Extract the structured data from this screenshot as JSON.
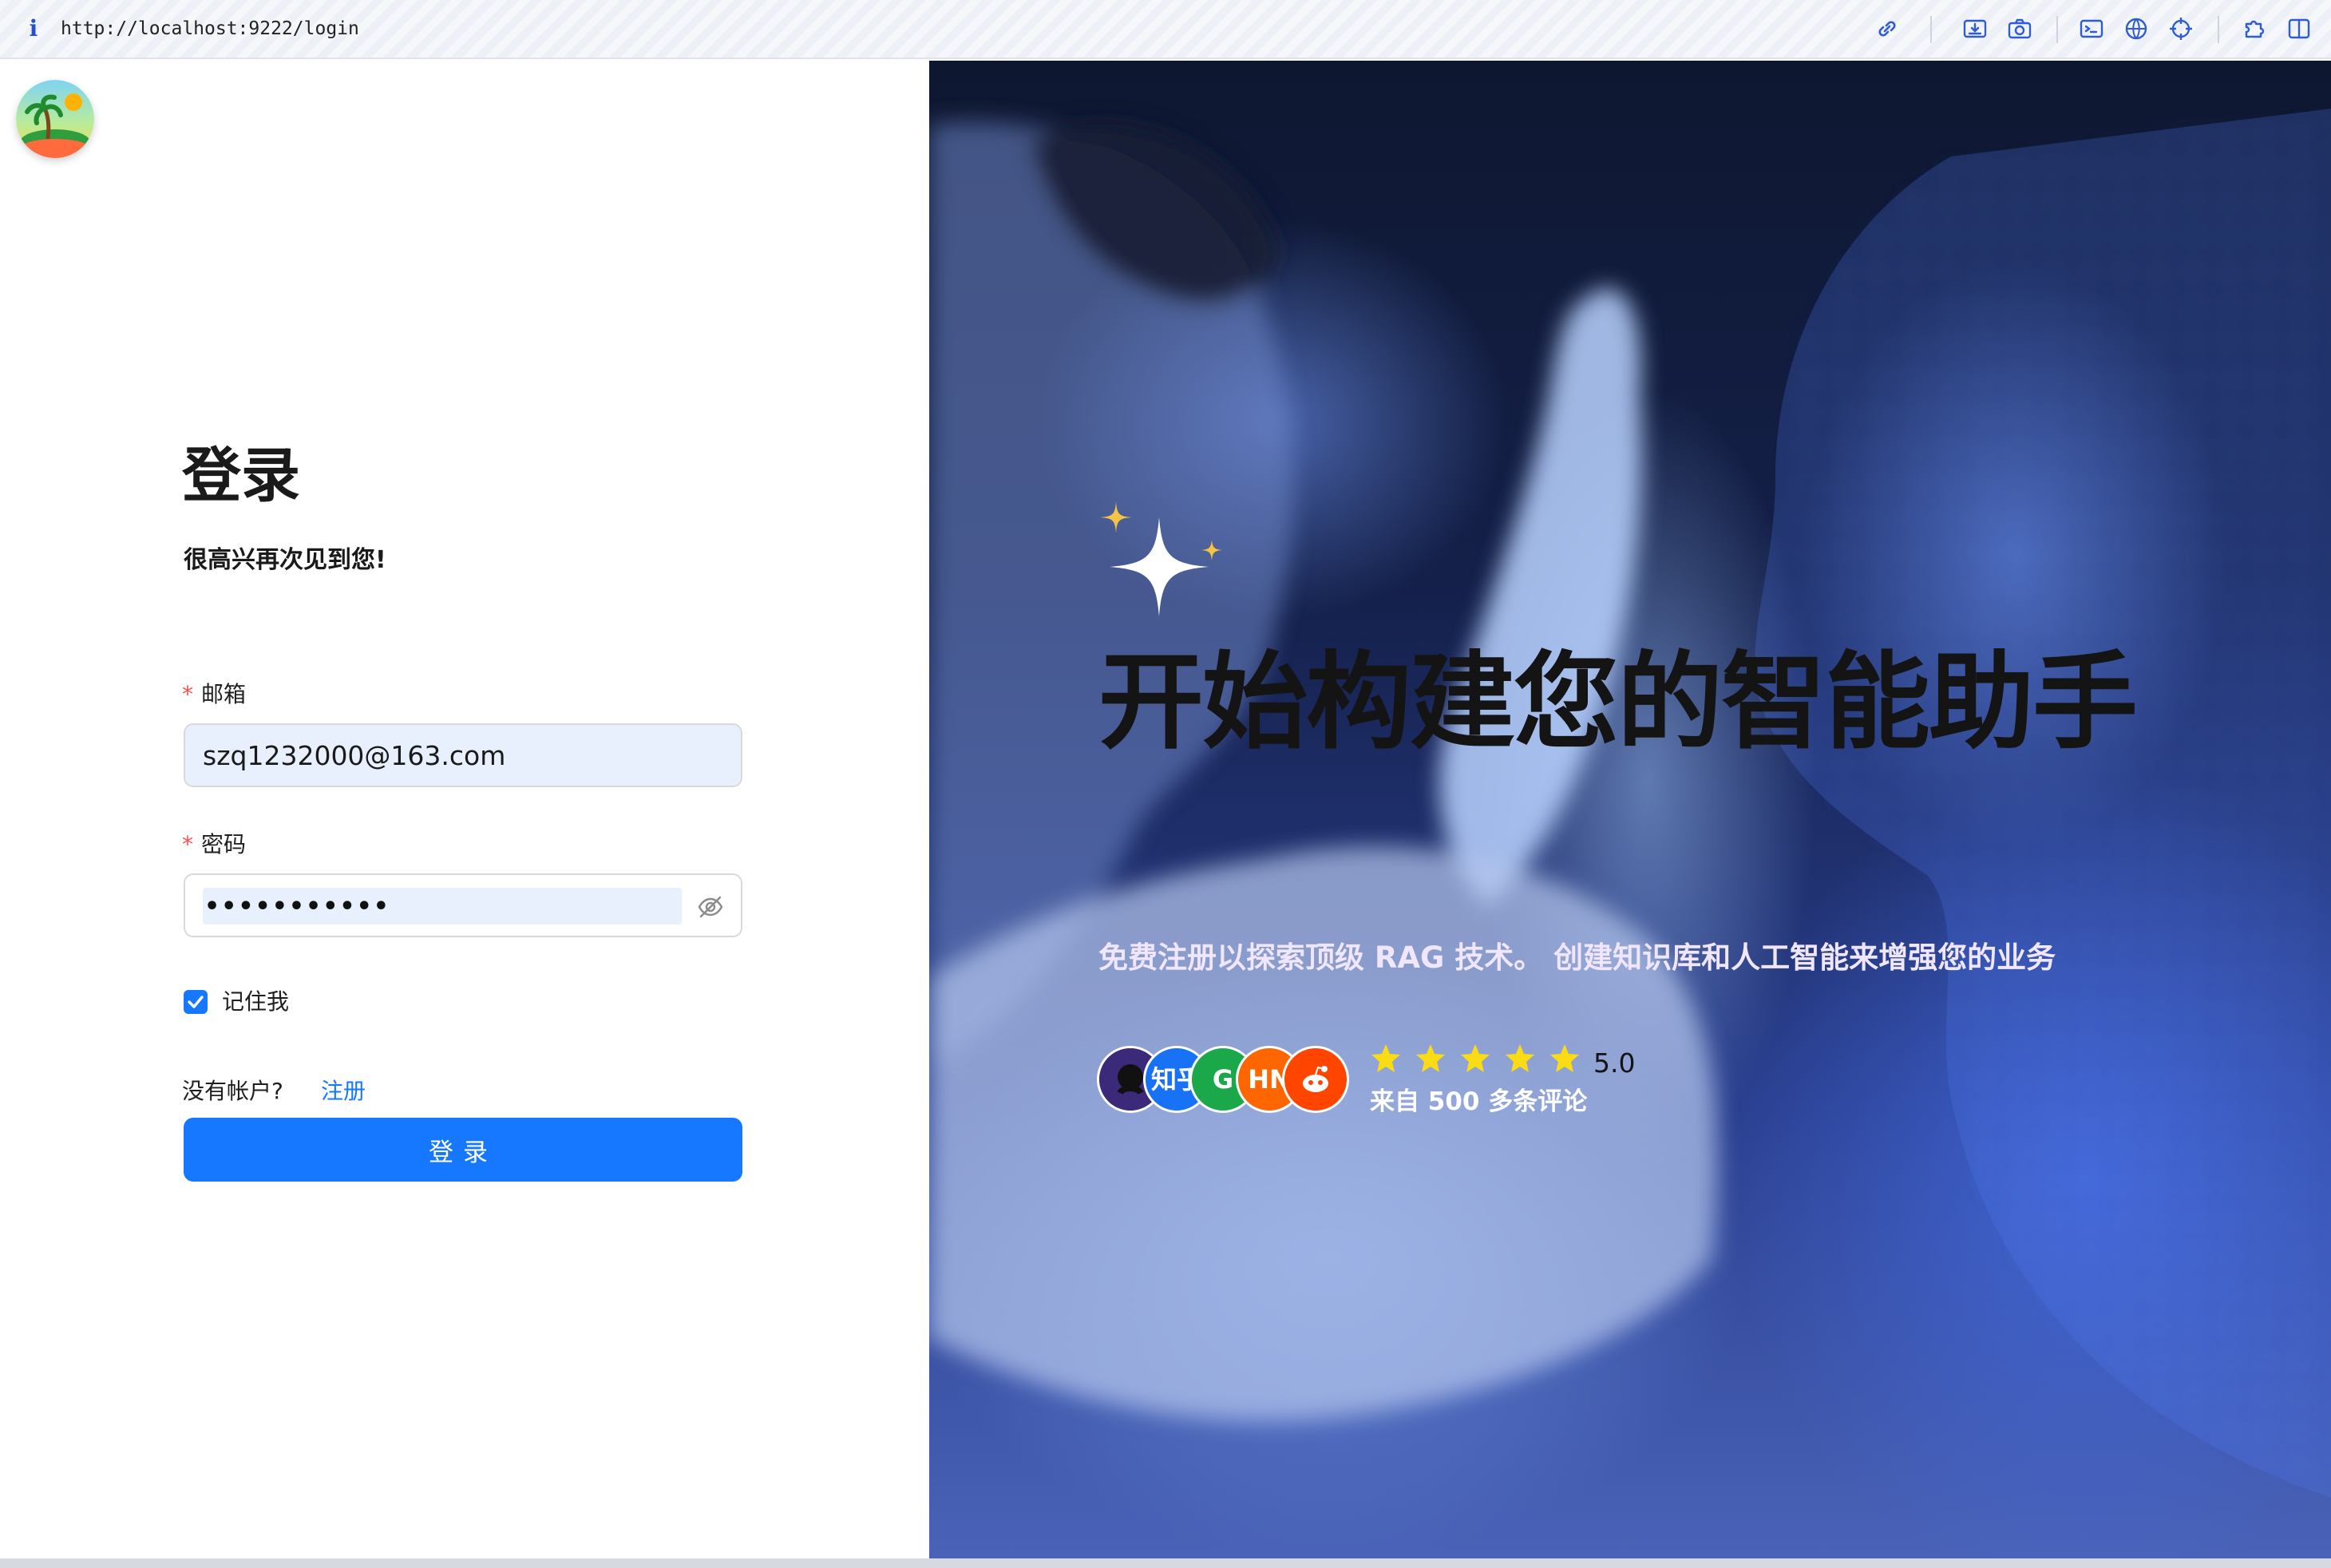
{
  "browser": {
    "url": "http://localhost:9222/login",
    "toolbar_icons": [
      "link-icon",
      "download-icon",
      "camera-icon",
      "terminal-icon",
      "globe-icon",
      "crosshair-icon",
      "puzzle-icon",
      "sidebar-icon"
    ]
  },
  "login": {
    "title": "登录",
    "subtitle": "很高兴再次见到您!",
    "email_label": "邮箱",
    "email_value": "szq1232000@163.com",
    "password_label": "密码",
    "password_value": "•••••••••••",
    "required_mark": "*",
    "remember_label": "记住我",
    "remember_checked": true,
    "no_account_text": "没有帐户?",
    "register_link": "注册",
    "submit_label": "登录"
  },
  "hero": {
    "title": "开始构建您的智能助手",
    "subtitle": "免费注册以探索顶级 RAG 技术。 创建知识库和人工智能来增强您的业务",
    "avatars": [
      {
        "label": "",
        "color": "#2b1a55"
      },
      {
        "label": "知乎",
        "color": "#1772f6"
      },
      {
        "label": "G",
        "color": "#1aa84b"
      },
      {
        "label": "HN",
        "color": "#ff6600"
      },
      {
        "label": "",
        "color": "#ff4500"
      }
    ],
    "rating": "5.0",
    "star_count": 5,
    "reviews_text": "来自 500 多条评论"
  },
  "colors": {
    "primary": "#1677ff",
    "required": "#ff4d4f",
    "star": "#fadb14"
  }
}
